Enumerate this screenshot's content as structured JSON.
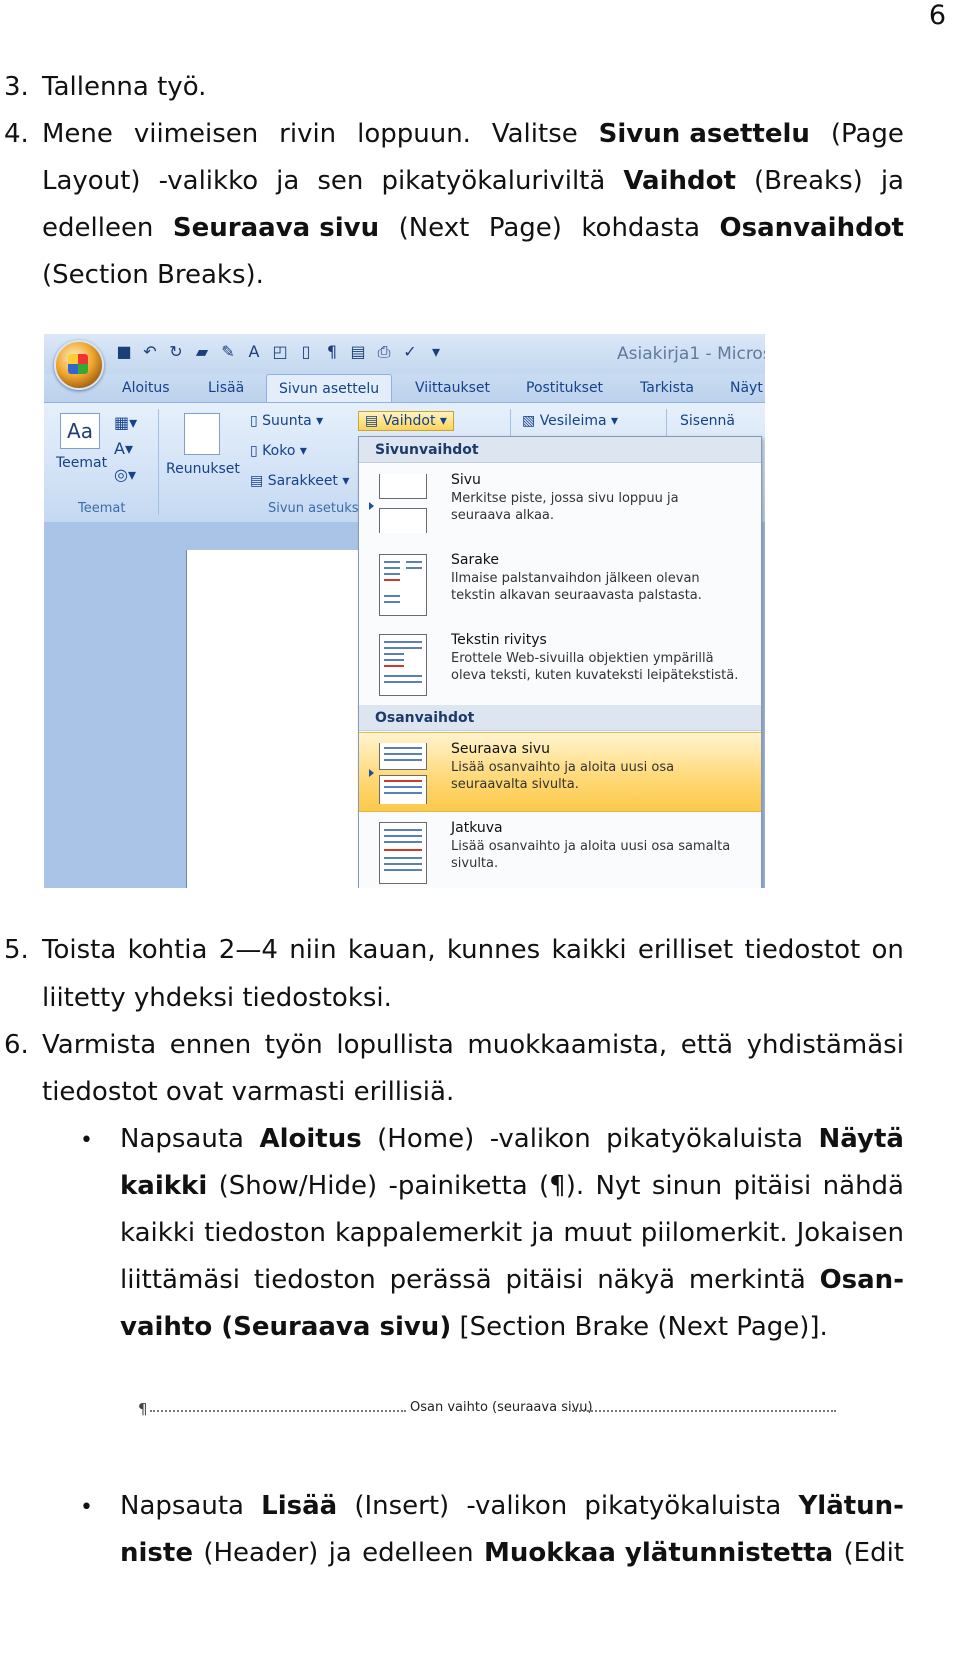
{
  "page_number": "6",
  "steps": {
    "s3": "3.",
    "s3_text": "Tallenna työ.",
    "s4": "4.",
    "s4_l1": [
      "Mene",
      "viimeisen",
      "rivin",
      "loppuun.",
      "Valitse",
      "Sivun asettelu",
      "(Page"
    ],
    "s4_l2": [
      "Layout)",
      "-valikko",
      "ja",
      "sen",
      "pikatyökaluriviltä",
      "Vaihdot",
      "(Breaks)",
      "ja"
    ],
    "s4_l3": [
      "edelleen",
      "Seuraava sivu",
      "(Next",
      "Page)",
      "kohdasta",
      "Osanvaihdot"
    ],
    "s4_l4": "(Section Breaks).",
    "s5": "5.",
    "s5_l1": [
      "Toista",
      "kohtia",
      "2—4",
      "niin",
      "kauan,",
      "kunnes",
      "kaikki",
      "erilliset",
      "tiedostot",
      "on"
    ],
    "s5_l2": "liitetty yhdeksi tiedostoksi.",
    "s6": "6.",
    "s6_l1": [
      "Varmista",
      "ennen",
      "työn",
      "lopullista",
      "muokkaamista,",
      "että",
      "yhdistämäsi"
    ],
    "s6_l2": "tiedostot ovat varmasti erillisiä.",
    "b1_l1": [
      "Napsauta",
      "Aloitus",
      "(Home)",
      "-valikon",
      "pikatyökaluista",
      "Näytä"
    ],
    "b1_l2a": "kaikki",
    "b1_l2b": [
      "(Show/Hide)",
      "-painiketta",
      "(¶).",
      "Nyt",
      "sinun",
      "pitäisi",
      "nähdä"
    ],
    "b1_l3": [
      "kaikki",
      "tiedoston",
      "kappalemerkit",
      "ja",
      "muut",
      "piilomerkit.",
      "Jokaisen"
    ],
    "b1_l4": [
      "liittämäsi",
      "tiedoston",
      "perässä",
      "pitäisi",
      "näkyä",
      "merkintä",
      "Osan-"
    ],
    "b1_l5a": "vaihto (Seuraava sivu)",
    "b1_l5b": "[Section Brake (Next Page)].",
    "b2_l1": [
      "Napsauta",
      "Lisää",
      "(Insert)",
      "-valikon",
      "pikatyökaluista",
      "Ylätun-"
    ],
    "b2_l2": [
      "niste",
      "(Header)",
      "ja",
      "edelleen",
      "Muokkaa ylätunnistetta",
      "(Edit"
    ]
  },
  "word": {
    "title": "Asiakirja1 - Micros",
    "tabs": [
      "Aloitus",
      "Lisää",
      "Sivun asettelu",
      "Viittaukset",
      "Postitukset",
      "Tarkista",
      "Näyt"
    ],
    "ribbon": {
      "teemat": "Teemat",
      "teemat_group": "Teemat",
      "reunukset": "Reunukset",
      "suunta": "Suunta ▾",
      "koko": "Koko ▾",
      "sarakkeet": "Sarakkeet ▾",
      "sivun_asetukset_group": "Sivun asetuks",
      "vaihdot": "Vaihdot ▾",
      "vesileima": "Vesileima ▾",
      "sisenna": "Sisennä"
    },
    "menu": {
      "sivunvaihdot": "Sivunvaihdot",
      "osanvaihdot": "Osanvaihdot",
      "items": [
        {
          "title": "Sivu",
          "desc1": "Merkitse piste, jossa sivu loppuu ja",
          "desc2": "seuraava alkaa."
        },
        {
          "title": "Sarake",
          "desc1": "Ilmaise palstanvaihdon jälkeen olevan",
          "desc2": "tekstin alkavan seuraavasta palstasta."
        },
        {
          "title": "Tekstin rivitys",
          "desc1": "Erottele Web-sivuilla objektien ympärillä",
          "desc2": "oleva teksti, kuten kuvateksti leipätekstistä."
        },
        {
          "title": "Seuraava sivu",
          "desc1": "Lisää osanvaihto ja aloita uusi osa",
          "desc2": "seuraavalta sivulta."
        },
        {
          "title": "Jatkuva",
          "desc1": "Lisää osanvaihto ja aloita uusi osa samalta",
          "desc2": "sivulta."
        }
      ]
    }
  },
  "section_break": {
    "pilcrow": "¶",
    "label": "Osan vaihto (seuraava sivu)"
  },
  "bullet": "•"
}
